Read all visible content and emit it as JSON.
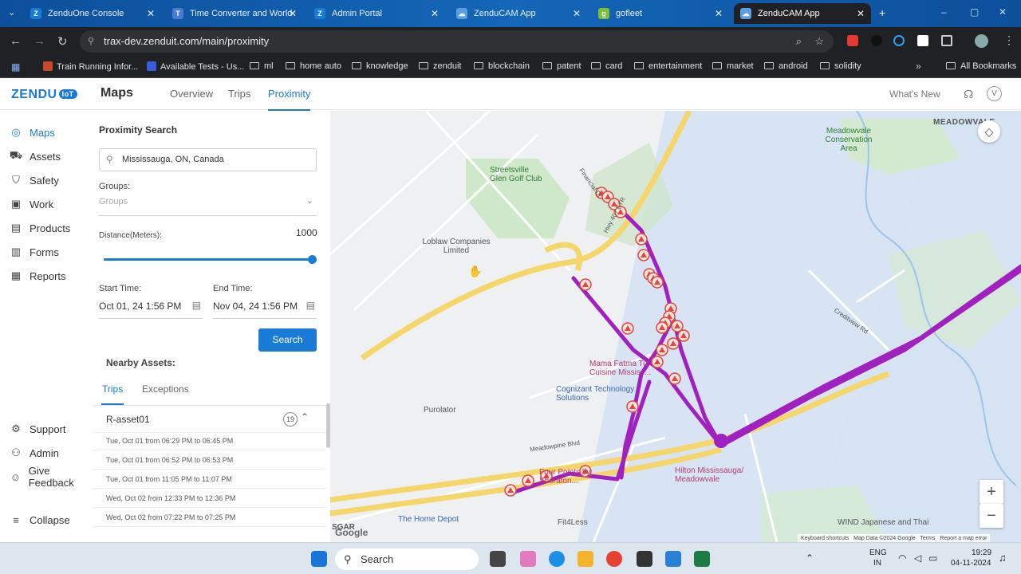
{
  "browser": {
    "tabs": [
      {
        "title": "ZenduOne Console",
        "icon_color": "#1a7bd6",
        "icon_letter": "Z"
      },
      {
        "title": "Time Converter and World",
        "icon_color": "#4a7bd0",
        "icon_letter": "T"
      },
      {
        "title": "Admin Portal",
        "icon_color": "#1a7bd6",
        "icon_letter": "Z"
      },
      {
        "title": "ZenduCAM App",
        "icon_color": "#5aa0e0",
        "icon_letter": "☁"
      },
      {
        "title": "gofleet",
        "icon_color": "#7bbf3a",
        "icon_letter": "g"
      },
      {
        "title": "ZenduCAM App",
        "icon_color": "#5aa0e0",
        "icon_letter": "☁"
      }
    ],
    "active_tab_index": 5,
    "url": "trax-dev.zenduit.com/main/proximity",
    "bookmarks": [
      "Train Running Infor...",
      "Available Tests - Us...",
      "ml",
      "home auto",
      "knowledge",
      "zenduit",
      "blockchain",
      "patent",
      "card",
      "entertainment",
      "market",
      "android",
      "solidity"
    ],
    "all_bookmarks_label": "All Bookmarks"
  },
  "app": {
    "logo_text": "ZENDU",
    "logo_badge": "IoT",
    "page_title": "Maps",
    "nav_tabs": [
      "Overview",
      "Trips",
      "Proximity"
    ],
    "active_nav_tab": "Proximity",
    "whats_new": "What's New",
    "avatar_letter": "V",
    "accent_color": "#1a7bd6"
  },
  "sidebar": {
    "items": [
      {
        "label": "Maps",
        "icon": "map-pin-icon",
        "glyph": "◎"
      },
      {
        "label": "Assets",
        "icon": "truck-icon",
        "glyph": "⛟"
      },
      {
        "label": "Safety",
        "icon": "shield-icon",
        "glyph": "⛉"
      },
      {
        "label": "Work",
        "icon": "briefcase-icon",
        "glyph": "▣"
      },
      {
        "label": "Products",
        "icon": "box-icon",
        "glyph": "▤"
      },
      {
        "label": "Forms",
        "icon": "form-icon",
        "glyph": "▥"
      },
      {
        "label": "Reports",
        "icon": "bar-chart-icon",
        "glyph": "▦"
      }
    ],
    "bottom_items": [
      {
        "label": "Support",
        "icon": "support-icon",
        "glyph": "⚙"
      },
      {
        "label": "Admin",
        "icon": "user-icon",
        "glyph": "⚇"
      },
      {
        "label": "Give Feedback",
        "icon": "feedback-icon",
        "glyph": "☺"
      }
    ],
    "collapse_label": "Collapse"
  },
  "proximity": {
    "title": "Proximity Search",
    "location": "Mississauga, ON, Canada",
    "groups_label": "Groups:",
    "groups_placeholder": "Groups",
    "distance_label": "Distance(Meters):",
    "distance_value": "1000",
    "distance_slider_fraction": 1.0,
    "start_label": "Start Time:",
    "start_value": "Oct 01, 24 1:56 PM",
    "end_label": "End Time:",
    "end_value": "Nov 04, 24 1:56 PM",
    "search_button": "Search",
    "nearby_label": "Nearby Assets:",
    "sub_tabs": [
      "Trips",
      "Exceptions"
    ],
    "asset": {
      "name": "R-asset01",
      "count": "19"
    },
    "trips": [
      "Tue, Oct 01 from 06:29 PM to 06:45 PM",
      "Tue, Oct 01 from 06:52 PM to 06:53 PM",
      "Tue, Oct 01 from 11:05 PM to 11:07 PM",
      "Wed, Oct 02 from 12:33 PM to 12:36 PM",
      "Wed, Oct 02 from 07:22 PM to 07:25 PM"
    ]
  },
  "map": {
    "labels": {
      "meadowvale": "MEADOWVALE",
      "conservation": "Meadowvale Conservation Area",
      "golf": "Streetsville Glen Golf Club",
      "loblaw": "Loblaw Companies Limited",
      "mama": "Mama Fatma Tu Cuisine Mississ...",
      "cognizant": "Cognizant Technology Solutions",
      "purolator": "Purolator",
      "hilton": "Hilton Mississauga/ Meadowvale",
      "fourpoints": "Four Points by Sheraton...",
      "homedepot": "The Home Depot",
      "fit4less": "Fit4Less",
      "wind": "WIND Japanese and Thai",
      "gar": "SGAR",
      "hwy": "Hwy 407 ETR",
      "creditview": "Creditview Rd",
      "meadowpine": "Meadowpine Blvd",
      "financial": "Financial Dr"
    },
    "footer": [
      "Keyboard shortcuts",
      "Map Data ©2024 Google",
      "Terms",
      "Report a map error"
    ],
    "google": "Google",
    "route_color": "#a020c0",
    "event_color": "#e0483a"
  },
  "taskbar": {
    "search_placeholder": "Search",
    "lang": "ENG",
    "region": "IN",
    "time": "19:29",
    "date": "04-11-2024"
  }
}
